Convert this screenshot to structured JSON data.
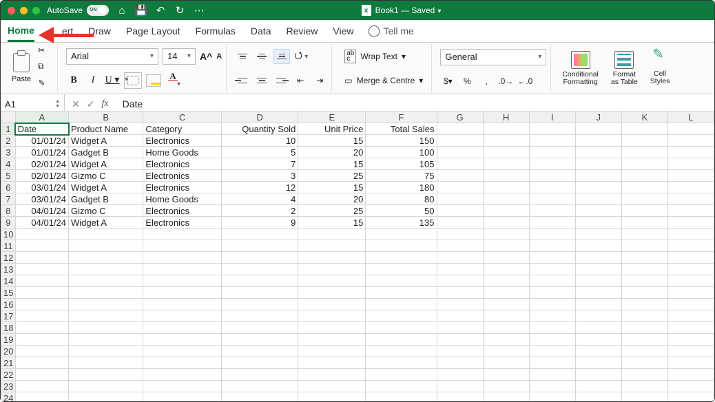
{
  "titlebar": {
    "autosave_label": "AutoSave",
    "doc_title": "Book1 — Saved"
  },
  "tabs": {
    "home": "Home",
    "insert": "ert",
    "draw": "Draw",
    "page_layout": "Page Layout",
    "formulas": "Formulas",
    "data": "Data",
    "review": "Review",
    "view": "View",
    "tellme": "Tell me"
  },
  "ribbon": {
    "paste_label": "Paste",
    "font_name": "Arial",
    "font_size": "14",
    "wrap_label": "Wrap Text",
    "merge_label": "Merge & Centre",
    "number_format": "General",
    "cond_fmt_line1": "Conditional",
    "cond_fmt_line2": "Formatting",
    "fmt_table_line1": "Format",
    "fmt_table_line2": "as Table",
    "cell_styles_line1": "Cell",
    "cell_styles_line2": "Styles"
  },
  "fbar": {
    "cell_ref": "A1",
    "formula_value": "Date"
  },
  "columns": [
    "A",
    "B",
    "C",
    "D",
    "E",
    "F",
    "G",
    "H",
    "I",
    "J",
    "K",
    "L"
  ],
  "headers": {
    "date": "Date",
    "product": "Product Name",
    "category": "Category",
    "qty": "Quantity Sold",
    "price": "Unit Price",
    "total": "Total Sales"
  },
  "rows": [
    {
      "date": "01/01/24",
      "product": "Widget A",
      "category": "Electronics",
      "qty": "10",
      "price": "15",
      "total": "150"
    },
    {
      "date": "01/01/24",
      "product": "Gadget B",
      "category": "Home Goods",
      "qty": "5",
      "price": "20",
      "total": "100"
    },
    {
      "date": "02/01/24",
      "product": "Widget A",
      "category": "Electronics",
      "qty": "7",
      "price": "15",
      "total": "105"
    },
    {
      "date": "02/01/24",
      "product": "Gizmo C",
      "category": "Electronics",
      "qty": "3",
      "price": "25",
      "total": "75"
    },
    {
      "date": "03/01/24",
      "product": "Widget A",
      "category": "Electronics",
      "qty": "12",
      "price": "15",
      "total": "180"
    },
    {
      "date": "03/01/24",
      "product": "Gadget B",
      "category": "Home Goods",
      "qty": "4",
      "price": "20",
      "total": "80"
    },
    {
      "date": "04/01/24",
      "product": "Gizmo C",
      "category": "Electronics",
      "qty": "2",
      "price": "25",
      "total": "50"
    },
    {
      "date": "04/01/24",
      "product": "Widget A",
      "category": "Electronics",
      "qty": "9",
      "price": "15",
      "total": "135"
    }
  ]
}
